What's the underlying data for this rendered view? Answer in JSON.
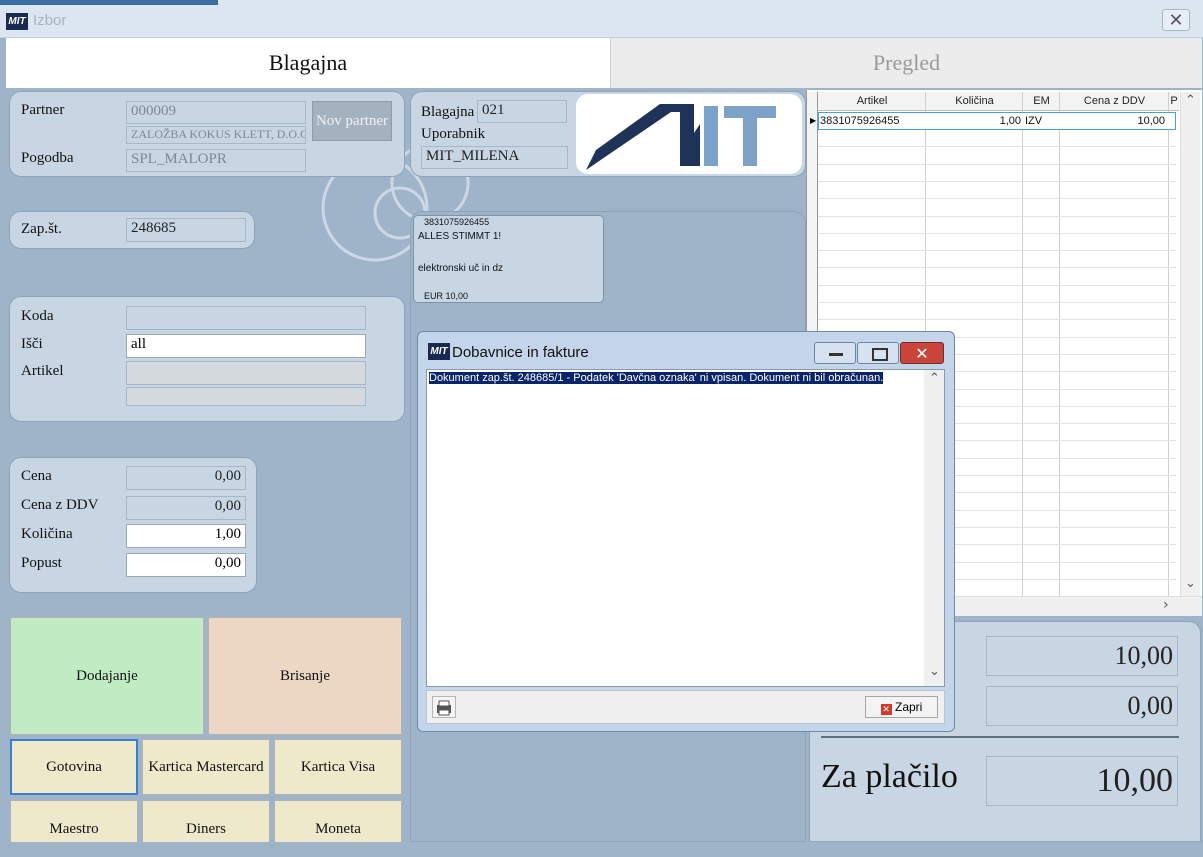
{
  "window": {
    "title": "Izbor",
    "close_glyph": "✕"
  },
  "tabs": [
    {
      "label": "Blagajna"
    },
    {
      "label": "Pregled"
    }
  ],
  "partner": {
    "partner_label": "Partner",
    "partner_code": "000009",
    "partner_name": "ZALOŽBA KOKUS KLETT, D.O.O.",
    "new_partner_button": "Nov partner",
    "contract_label": "Pogodba",
    "contract_value": "SPL_MALOPR"
  },
  "register": {
    "register_label": "Blagajna",
    "register_value": "021",
    "user_label": "Uporabnik",
    "user_value": "MIT_MILENA",
    "logo_text": "MIT"
  },
  "doc": {
    "label": "Zap.št.",
    "value": "248685"
  },
  "item_card": {
    "barcode": "3831075926455",
    "line1": "ALLES STIMMT 1!",
    "line2": "elektronski uč in dz",
    "price": "EUR 10,00"
  },
  "search": {
    "code_label": "Koda",
    "code_value": "",
    "search_label": "Išči",
    "search_value": "all",
    "article_label": "Artikel",
    "article_value": "",
    "article_value2": ""
  },
  "price": {
    "price_label": "Cena",
    "price_value": "0,00",
    "price_vat_label": "Cena z DDV",
    "price_vat_value": "0,00",
    "qty_label": "Količina",
    "qty_value": "1,00",
    "discount_label": "Popust",
    "discount_value": "0,00"
  },
  "actions": {
    "add": "Dodajanje",
    "delete": "Brisanje"
  },
  "payments": [
    "Gotovina",
    "Kartica Mastercard",
    "Kartica Visa",
    "Maestro",
    "Diners",
    "Moneta"
  ],
  "grid": {
    "columns": [
      "Artikel",
      "Količina",
      "EM",
      "Cena z DDV",
      "P"
    ],
    "rows": [
      {
        "article": "3831075926455",
        "qty": "1,00",
        "em": "IZV",
        "price": "10,00"
      }
    ]
  },
  "totals": {
    "total1": "10,00",
    "total2": "0,00",
    "to_pay_label": "Za plačilo",
    "to_pay_value": "10,00"
  },
  "dialog": {
    "title": "Dobavnice in fakture",
    "message": "Dokument zap.št. 248685/1 - Podatek 'Davčna oznaka' ni vpisan. Dokument ni bil obračunan.",
    "close_button": "Zapri"
  },
  "colors": {
    "add_button": "#c0ebc3",
    "delete_button": "#ecd7c5",
    "payment_button": "#efe9cc",
    "panel": "#c8d6e4",
    "dialog_frame": "#c3d5ea",
    "close_red": "#c9443a",
    "logo_navy": "#1f3358",
    "logo_lightblue": "#7da2c8"
  }
}
